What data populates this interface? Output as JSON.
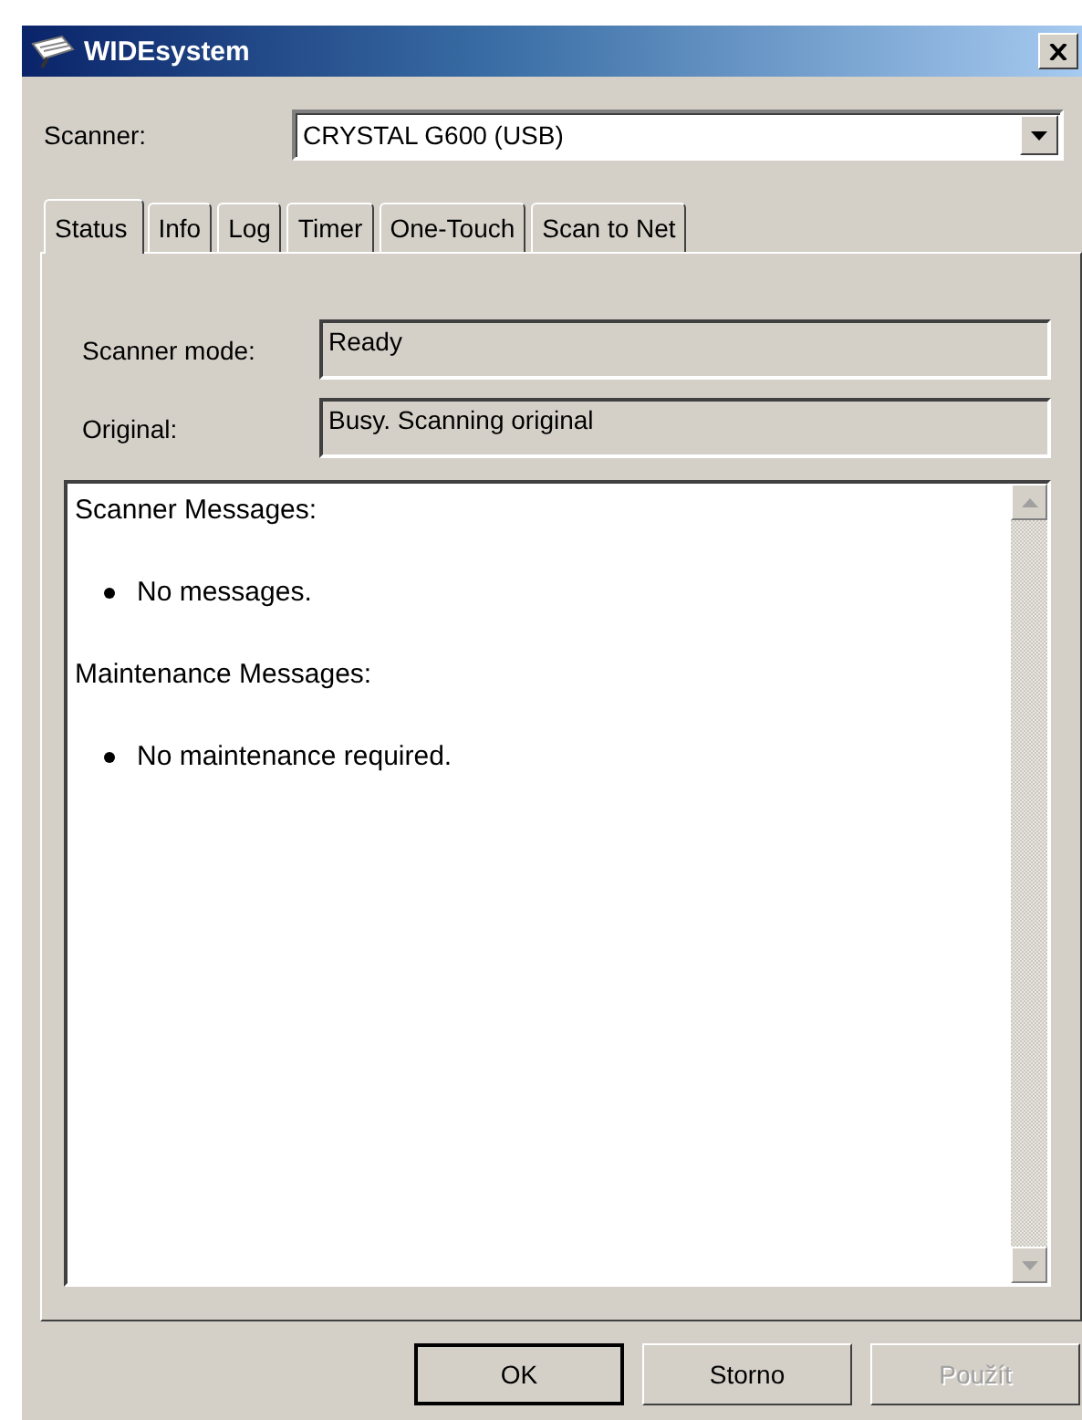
{
  "window": {
    "title": "WIDEsystem"
  },
  "scanner": {
    "label": "Scanner:",
    "value": "CRYSTAL G600 (USB)"
  },
  "tabs": [
    {
      "label": "Status",
      "selected": true
    },
    {
      "label": "Info",
      "selected": false
    },
    {
      "label": "Log",
      "selected": false
    },
    {
      "label": "Timer",
      "selected": false
    },
    {
      "label": "One-Touch",
      "selected": false
    },
    {
      "label": "Scan to Net",
      "selected": false
    }
  ],
  "fields": [
    {
      "label": "Scanner mode:",
      "value": "Ready"
    },
    {
      "label": "Original:",
      "value": "Busy. Scanning original"
    }
  ],
  "messages": [
    {
      "heading": "Scanner Messages:",
      "items": [
        "No messages."
      ]
    },
    {
      "heading": "Maintenance Messages:",
      "items": [
        "No maintenance required."
      ]
    }
  ],
  "buttons": [
    {
      "label": "OK",
      "default": true,
      "disabled": false
    },
    {
      "label": "Storno",
      "default": false,
      "disabled": false
    },
    {
      "label": "Použít",
      "default": false,
      "disabled": true
    }
  ]
}
